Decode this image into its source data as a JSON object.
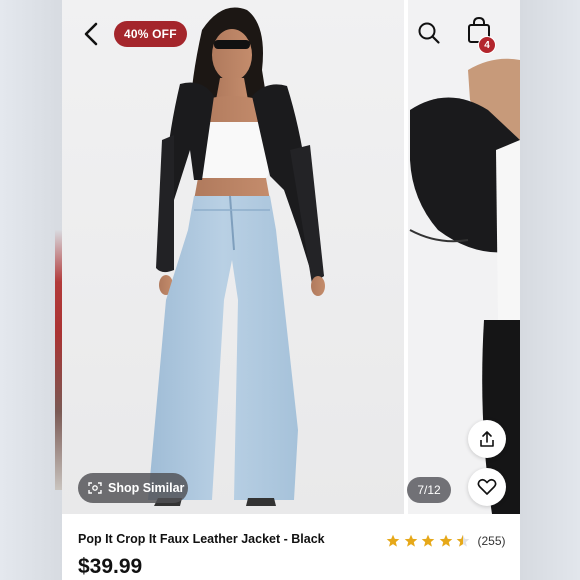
{
  "header": {
    "back_icon": "chevron-left-icon",
    "discount_badge": "40% OFF",
    "search_icon": "search-icon",
    "bag_icon": "shopping-bag-icon",
    "bag_count": "4"
  },
  "gallery": {
    "shop_similar_label": "Shop Similar",
    "shop_similar_icon": "camera-scan-icon",
    "image_counter": "7/12",
    "share_icon": "share-icon",
    "wishlist_icon": "heart-icon"
  },
  "product": {
    "title": "Pop It Crop It Faux Leather Jacket - Black",
    "price": "$39.99",
    "rating": 4.5,
    "review_count": "(255)"
  },
  "colors": {
    "badge_red": "#a4262c",
    "star_gold": "#e6a819"
  }
}
